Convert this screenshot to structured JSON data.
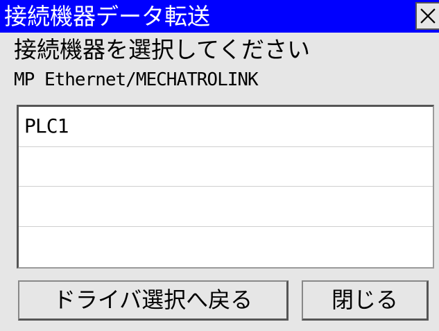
{
  "window": {
    "title": "接続機器データ転送",
    "close_icon": "close-x-icon"
  },
  "prompt": "接続機器を選択してください",
  "driver_name": "MP Ethernet/MECHATROLINK",
  "device_list": {
    "items": [
      "PLC1",
      "",
      "",
      ""
    ]
  },
  "buttons": {
    "back_label": "ドライバ選択へ戻る",
    "close_label": "閉じる"
  },
  "colors": {
    "titlebar": "#0000ff",
    "background": "#e6e6e6"
  }
}
